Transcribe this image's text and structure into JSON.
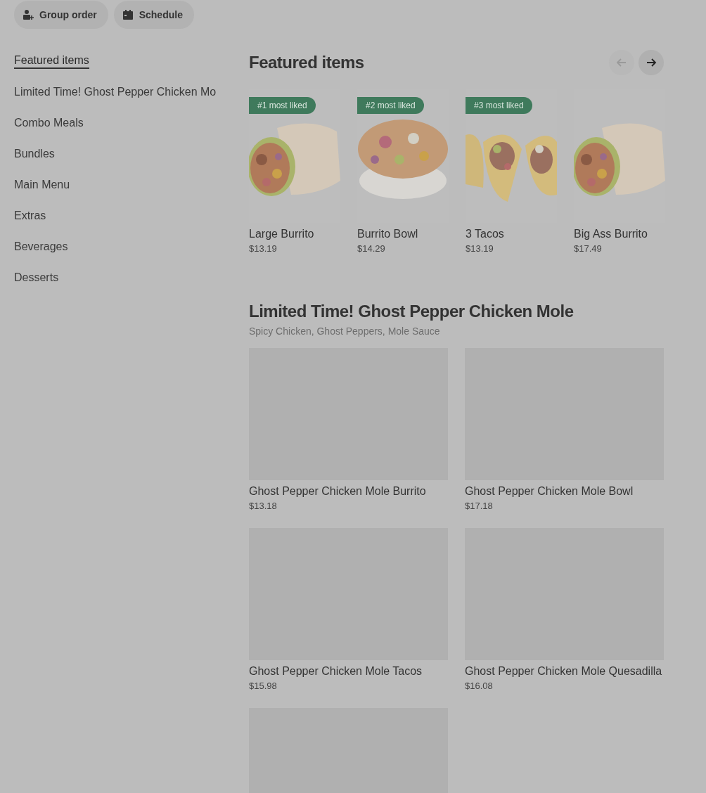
{
  "actions": [
    {
      "kind": "group",
      "label": "Group order"
    },
    {
      "kind": "schedule",
      "label": "Schedule"
    }
  ],
  "sidebar": {
    "items": [
      {
        "label": "Featured items",
        "selected": true
      },
      {
        "label": "Limited Time! Ghost Pepper Chicken Mo",
        "selected": false
      },
      {
        "label": "Combo Meals",
        "selected": false
      },
      {
        "label": "Bundles",
        "selected": false
      },
      {
        "label": "Main Menu",
        "selected": false
      },
      {
        "label": "Extras",
        "selected": false
      },
      {
        "label": "Beverages",
        "selected": false
      },
      {
        "label": "Desserts",
        "selected": false
      }
    ]
  },
  "featured": {
    "title": "Featured items",
    "prev_disabled": true,
    "next_disabled": false,
    "items": [
      {
        "badge": "#1 most liked",
        "kind": "picture",
        "name": "Large Burrito",
        "price": "$13.19"
      },
      {
        "badge": "#2 most liked",
        "kind": "picture",
        "name": "Burrito Bowl",
        "price": "$14.29"
      },
      {
        "badge": "#3 most liked",
        "kind": "picture",
        "name": "3 Tacos",
        "price": "$13.19"
      },
      {
        "kind": "picture",
        "name": "Big Ass Burrito",
        "price": "$17.49"
      }
    ]
  },
  "section": {
    "title": "Limited Time! Ghost Pepper Chicken Mole",
    "subtitle": "Spicy Chicken, Ghost Peppers, Mole Sauce",
    "items": [
      {
        "kind": "placeholder",
        "name": "Ghost Pepper Chicken Mole Burrito",
        "price": "$13.18"
      },
      {
        "kind": "placeholder",
        "name": "Ghost Pepper Chicken Mole Bowl",
        "price": "$17.18"
      },
      {
        "kind": "placeholder",
        "name": "Ghost Pepper Chicken Mole Tacos",
        "price": "$15.98"
      },
      {
        "kind": "placeholder",
        "name": "Ghost Pepper Chicken Mole Quesadilla",
        "price": "$16.08"
      },
      {
        "kind": "placeholder"
      }
    ]
  }
}
